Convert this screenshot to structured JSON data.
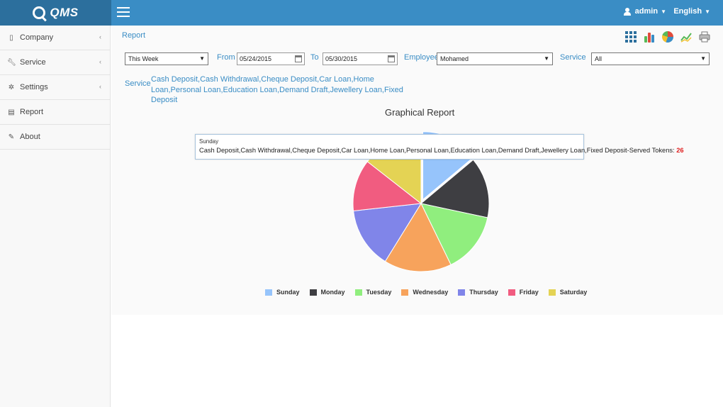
{
  "app": {
    "logo_text": "QMS"
  },
  "header": {
    "user": "admin",
    "language": "English"
  },
  "sidebar": {
    "items": [
      {
        "label": "Company",
        "icon": "building-icon",
        "has_submenu": true
      },
      {
        "label": "Service",
        "icon": "wrench-icon",
        "has_submenu": true
      },
      {
        "label": "Settings",
        "icon": "gear-icon",
        "has_submenu": true
      },
      {
        "label": "Report",
        "icon": "document-icon",
        "has_submenu": false
      },
      {
        "label": "About",
        "icon": "edit-icon",
        "has_submenu": false
      }
    ]
  },
  "page": {
    "title": "Report"
  },
  "toolbar": {
    "icons": [
      "grid-icon",
      "bar-chart-icon",
      "pie-chart-icon",
      "line-chart-icon",
      "print-icon"
    ]
  },
  "filters": {
    "period": "This Week",
    "from_label": "From",
    "from_value": "05/24/2015",
    "to_label": "To",
    "to_value": "05/30/2015",
    "employee_label": "Employee",
    "employee_value": "Mohamed",
    "service_label": "Service",
    "service_value": "All"
  },
  "service_summary": {
    "label": "Service",
    "text": "Cash Deposit,Cash Withdrawal,Cheque Deposit,Car Loan,Home Loan,Personal Loan,Education Loan,Demand Draft,Jewellery Loan,Fixed Deposit"
  },
  "chart_data": {
    "type": "pie",
    "title": "Graphical Report",
    "categories": [
      "Sunday",
      "Monday",
      "Tuesday",
      "Wednesday",
      "Thursday",
      "Friday",
      "Saturday"
    ],
    "values": [
      26,
      27,
      27,
      30,
      27,
      23,
      27
    ],
    "colors": [
      "#96c4fb",
      "#3e3e42",
      "#90ee7e",
      "#f7a35c",
      "#8085e9",
      "#f15c80",
      "#e4d354"
    ],
    "legend_position": "bottom"
  },
  "tooltip": {
    "category": "Sunday",
    "text": "Cash Deposit,Cash Withdrawal,Cheque Deposit,Car Loan,Home Loan,Personal Loan,Education Loan,Demand Draft,Jewellery Loan,Fixed Deposit-Served Tokens: ",
    "value": "26"
  },
  "colors": {
    "topbar": "#3a8dc5",
    "brand": "#2c6f9d",
    "accent": "#3a8dc5"
  }
}
